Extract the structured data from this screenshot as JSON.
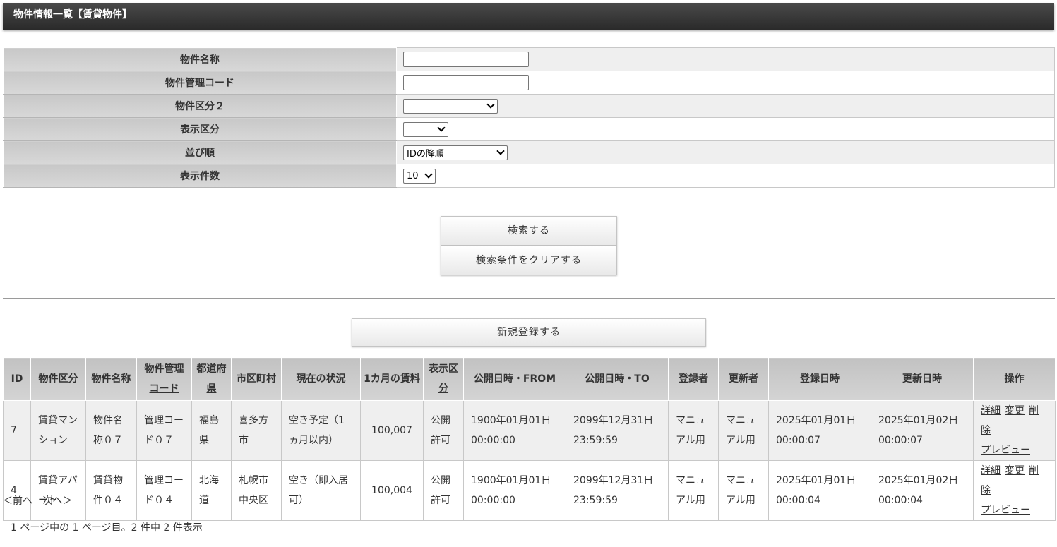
{
  "title": "物件情報一覧【賃貸物件】",
  "search": {
    "rows": [
      {
        "label": "物件名称",
        "type": "text",
        "value": ""
      },
      {
        "label": "物件管理コード",
        "type": "text",
        "value": ""
      },
      {
        "label": "物件区分２",
        "type": "select",
        "value": ""
      },
      {
        "label": "表示区分",
        "type": "select",
        "value": ""
      },
      {
        "label": "並び順",
        "type": "select",
        "value": "IDの降順"
      },
      {
        "label": "表示件数",
        "type": "select",
        "value": "10"
      }
    ],
    "search_button": "検索する",
    "clear_button": "検索条件をクリアする"
  },
  "new_button": "新規登録する",
  "table": {
    "headers": [
      "ID",
      "物件区分",
      "物件名称",
      "物件管理コード",
      "都道府県",
      "市区町村",
      "現在の状況",
      "1カ月の賃料",
      "表示区分",
      "公開日時・FROM",
      "公開日時・TO",
      "登録者",
      "更新者",
      "登録日時",
      "更新日時",
      "操作"
    ],
    "rows": [
      [
        "7",
        "賃貸マンション",
        "物件名称０７",
        "管理コード０７",
        "福島県",
        "喜多方市",
        "空き予定（1ヵ月以内）",
        "100,007",
        "公開許可",
        "1900年01月01日 00:00:00",
        "2099年12月31日 23:59:59",
        "マニュアル用",
        "マニュアル用",
        "2025年01月01日 00:00:07",
        "2025年01月02日 00:00:07"
      ],
      [
        "4",
        "賃貸アパート",
        "賃貸物件０４",
        "管理コード０４",
        "北海道",
        "札幌市中央区",
        "空き（即入居可）",
        "100,004",
        "公開許可",
        "1900年01月01日 00:00:00",
        "2099年12月31日 23:59:59",
        "マニュアル用",
        "マニュアル用",
        "2025年01月01日 00:00:04",
        "2025年01月02日 00:00:04"
      ]
    ],
    "ops": {
      "detail": "詳細",
      "edit": "変更",
      "delete": "削除",
      "preview": "プレビュー"
    }
  },
  "pager": {
    "prev": "＜前へ",
    "next": "次へ＞"
  },
  "page_info": "1 ページ中の 1 ページ目。2 件中 2 件表示"
}
